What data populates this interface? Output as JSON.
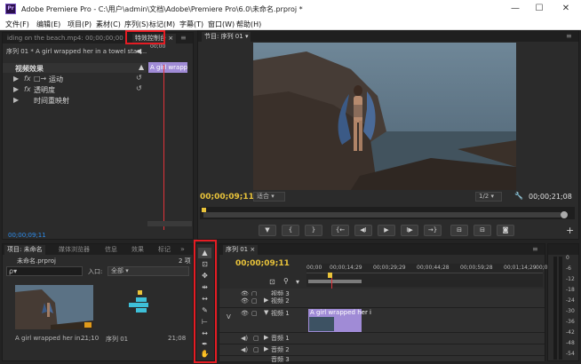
{
  "window": {
    "logo": "Pr",
    "title": "Adobe Premiere Pro - C:\\用户\\admin\\文档\\Adobe\\Premiere Pro\\6.0\\未命名.prproj *",
    "min": "—",
    "max": "☐",
    "close": "✕"
  },
  "menu": [
    "文件(F)",
    "编辑(E)",
    "项目(P)",
    "素材(C)",
    "序列(S)",
    "标记(M)",
    "字幕(T)",
    "窗口(W)",
    "帮助(H)"
  ],
  "effect_controls": {
    "tab_left": "iding on the beach.mp4: 00;00;00;00",
    "tab_active": "特效控制台",
    "tab_close": "×",
    "header": "序列 01 * A girl wrapped her in a towel stan...",
    "mini_time": "00;00",
    "mini_clip": "A girl wrappe",
    "section": "视频效果",
    "items": [
      {
        "fx": "fx",
        "icon": "□→",
        "label": "运动"
      },
      {
        "fx": "fx",
        "icon": "",
        "label": "透明度"
      },
      {
        "fx": "",
        "icon": "",
        "label": "时间重映射"
      }
    ],
    "bottom_time": "00;00;09;11"
  },
  "program": {
    "tab": "节目: 序列 01",
    "timecode_left": "00;00;09;11",
    "fit": "适合",
    "quality": "1/2",
    "timecode_right": "00;00;21;08",
    "wrench": "🔧",
    "transport": [
      "▼",
      "{",
      "}",
      "{←",
      "◀I",
      "▶",
      "I▶",
      "→}",
      "⊟",
      "⊟",
      "◙"
    ],
    "plus": "+"
  },
  "project": {
    "tabs": [
      "项目: 未命名",
      "媒体浏览器",
      "信息",
      "效果",
      "标记"
    ],
    "tabs_more": "»",
    "file": "未命名.prproj",
    "count": "2 项",
    "search_placeholder": "ρ▾",
    "in_label": "入口:",
    "in_value": "全部",
    "items": [
      {
        "name": "A girl wrapped her in...",
        "duration": "21;10"
      },
      {
        "name": "序列 01",
        "duration": "21;08"
      }
    ]
  },
  "tools": [
    "▲",
    "⊡",
    "✥",
    "⇹",
    "↔",
    "✎",
    "⊢",
    "↔",
    "✒",
    "✋",
    "🔍"
  ],
  "timeline": {
    "tab": "序列 01",
    "tab_close": "×",
    "timecode": "00;00;09;11",
    "ruler": [
      "00;00",
      "00;00;14;29",
      "00;00;29;29",
      "00;00;44;28",
      "00;00;59;28",
      "00;01;14;29",
      "00;0"
    ],
    "tracks": [
      {
        "label": "视频 3",
        "type": "video"
      },
      {
        "label": "视频 2",
        "type": "video"
      },
      {
        "label": "视频 1",
        "type": "video"
      },
      {
        "label": "音频 1",
        "type": "audio"
      },
      {
        "label": "音频 2",
        "type": "audio"
      },
      {
        "label": "音频 3",
        "type": "audio"
      }
    ],
    "v_label": "V",
    "clip_label": "A girl wrapped her i",
    "meter_labels": [
      "0",
      "-6",
      "-12",
      "-18",
      "-24",
      "-30",
      "-36",
      "-42",
      "-48",
      "-54"
    ]
  },
  "colors": {
    "accent_red": "#e51c23",
    "timecode_blue": "#2d8ceb",
    "playhead_yellow": "#e9c33a",
    "clip_purple": "#a08bd6"
  }
}
